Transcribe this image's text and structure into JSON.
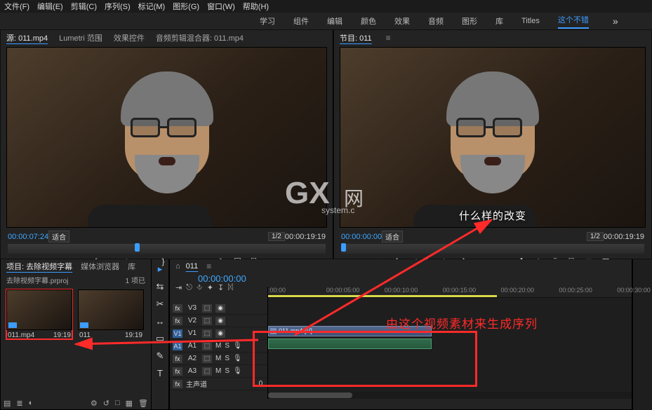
{
  "menu": {
    "items": [
      "文件(F)",
      "编辑(E)",
      "剪辑(C)",
      "序列(S)",
      "标记(M)",
      "图形(G)",
      "窗口(W)",
      "帮助(H)"
    ]
  },
  "workspaces": {
    "items": [
      "学习",
      "组件",
      "编辑",
      "颜色",
      "效果",
      "音频",
      "图形",
      "库",
      "Titles"
    ],
    "active": "这个不错",
    "plus": "»"
  },
  "source": {
    "tabs": {
      "main": "源: 011.mp4",
      "lumetri": "Lumetri 范围",
      "fx": "效果控件",
      "mixer": "音频剪辑混合器: 011.mp4"
    },
    "tc_in": "00:00:07:24",
    "tc_out": "00:00:19:19",
    "fit": "适合",
    "zoom": "1/2"
  },
  "program": {
    "tab": "节目: 011",
    "tc_in": "00:00:00:00",
    "tc_out": "00:00:19:19",
    "fit": "适合",
    "zoom": "1/2",
    "subtitle": "什么样的改变"
  },
  "transport_icons": [
    "⏮",
    "{",
    "◁",
    "▶",
    "▷",
    "}",
    "⏭",
    "✚",
    "⤓",
    "⤒",
    "⎘",
    "□",
    "◧"
  ],
  "transport_icons_src": [
    "▸",
    "{",
    "■",
    "▶",
    "■",
    "}",
    "◂",
    "⎆",
    "☐",
    "⎘"
  ],
  "project": {
    "tab_main": "项目: 去除视频字幕",
    "tab_browser": "媒体浏览器",
    "tab_lib": "库",
    "path": "去除视频字幕.prproj",
    "count": "1 项已",
    "bins": [
      {
        "name": "011.mp4",
        "dur": "19:19"
      },
      {
        "name": "011",
        "dur": "19:19"
      }
    ],
    "icon_row": [
      "▤",
      "≣",
      "◐",
      "⚙",
      "↺",
      "□",
      "▦",
      "🗑"
    ]
  },
  "tools": [
    "▸",
    "⇆",
    "✂",
    "↔",
    "▭",
    "✎",
    "T"
  ],
  "timeline": {
    "tab": "011",
    "tc": "00:00:00:00",
    "toolbar": [
      "⇥",
      "⎋",
      "⎀",
      "✦",
      "↧",
      "ᛞ"
    ],
    "ruler_ticks": [
      ":00:00",
      "00:00:05:00",
      "00:00:10:00",
      "00:00:15:00",
      "00:00:20:00",
      "00:00:25:00",
      "00:00:30:00"
    ],
    "v_tracks": [
      "V3",
      "V2",
      "V1"
    ],
    "a_tracks": [
      "A1",
      "A2",
      "A3"
    ],
    "mix_label": "主声道",
    "clip_label": "011.mp4 [V]"
  },
  "annotation": {
    "text": "由这个视频素材来生成序列"
  },
  "watermark": {
    "big": "GX",
    "small": "system.c",
    "right": "网"
  }
}
